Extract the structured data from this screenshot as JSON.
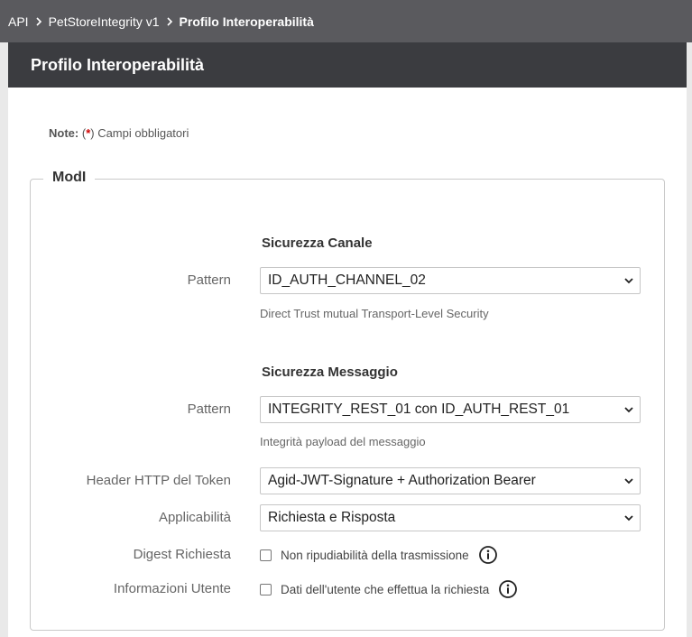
{
  "breadcrumb": {
    "items": [
      "API",
      "PetStoreIntegrity v1"
    ],
    "current": "Profilo Interoperabilità"
  },
  "header": {
    "title": "Profilo Interoperabilità"
  },
  "note": {
    "label": "Note:",
    "open": "(",
    "required_mark": "*",
    "text": ") Campi obbligatori"
  },
  "fieldset": {
    "legend": "ModI",
    "canale": {
      "title": "Sicurezza Canale",
      "pattern_label": "Pattern",
      "pattern_value": "ID_AUTH_CHANNEL_02",
      "pattern_help": "Direct Trust mutual Transport-Level Security"
    },
    "messaggio": {
      "title": "Sicurezza Messaggio",
      "pattern_label": "Pattern",
      "pattern_value": "INTEGRITY_REST_01 con ID_AUTH_REST_01",
      "pattern_help": "Integrità payload del messaggio",
      "header_label": "Header HTTP del Token",
      "header_value": "Agid-JWT-Signature + Authorization Bearer",
      "applicabilita_label": "Applicabilità",
      "applicabilita_value": "Richiesta e Risposta",
      "digest_label": "Digest Richiesta",
      "digest_checkbox": "Non ripudiabilità della trasmissione",
      "utente_label": "Informazioni Utente",
      "utente_checkbox": "Dati dell'utente che effettua la richiesta"
    }
  },
  "icons": {
    "breadcrumb_separator": "chevron-right-icon",
    "select_arrow": "chevron-down-icon",
    "info": "info-circle-icon"
  },
  "colors": {
    "breadcrumb_bg": "#5a5a5e",
    "header_bg": "#3b3c40",
    "required": "#d00000"
  }
}
